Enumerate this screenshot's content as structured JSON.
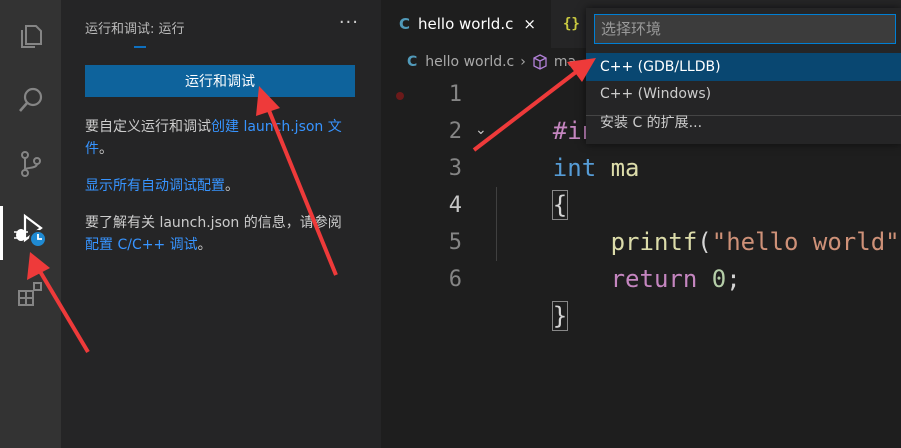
{
  "activity_bar": {
    "items": [
      {
        "icon": "files-icon"
      },
      {
        "icon": "search-icon"
      },
      {
        "icon": "source-control-icon"
      },
      {
        "icon": "run-debug-icon"
      },
      {
        "icon": "extensions-icon"
      }
    ]
  },
  "sidebar": {
    "title": "运行和调试: 运行",
    "more": "···",
    "run_button": "运行和调试",
    "text1_prefix": "要自定义运行和调试",
    "text1_link": "创建 launch.json 文件",
    "text1_suffix": "。",
    "show_all_link": "显示所有自动调试配置",
    "show_all_suffix": "。",
    "text3_prefix": "要了解有关 launch.json 的信息，请参阅 ",
    "text3_link": "配置 C/C++ 调试",
    "text3_suffix": "。"
  },
  "tabs": [
    {
      "icon_text": "C",
      "label": "hello world.c",
      "close": "×"
    },
    {
      "icon_text": "{}"
    }
  ],
  "breadcrumb": {
    "icon_text": "C",
    "file": "hello world.c",
    "sep": "›",
    "symbol": "ma"
  },
  "editor": {
    "line_numbers": [
      "1",
      "2",
      "3",
      "4",
      "5",
      "6"
    ],
    "fold_glyph": "⌄",
    "lines": {
      "l1_directive": "#inclu",
      "l2_type": "int",
      "l2_name": " ma",
      "l3_brace": "{",
      "l4_indent": "    ",
      "l4_fn": "printf",
      "l4_open": "(",
      "l4_str": "\"hello world\"",
      "l4_close": ");",
      "l5_indent": "    ",
      "l5_kw": "return",
      "l5_sp": " ",
      "l5_num": "0",
      "l5_semi": ";",
      "l6_brace": "}"
    }
  },
  "quickpick": {
    "placeholder": "选择环境",
    "options": [
      {
        "label": "C++ (GDB/LLDB)",
        "selected": true
      },
      {
        "label": "C++ (Windows)",
        "selected": false
      },
      {
        "label": "安装 C 的扩展...",
        "selected": false
      }
    ]
  },
  "colors": {
    "accent": "#0e639c",
    "link": "#3794ff",
    "annotation_arrow": "#ee3a3a"
  }
}
